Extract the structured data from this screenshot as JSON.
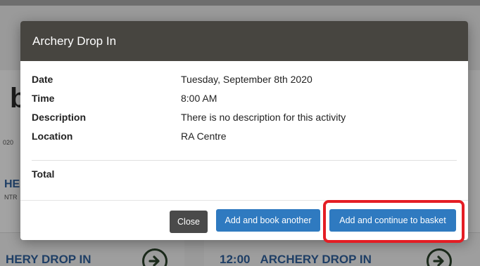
{
  "background": {
    "big_letter": "b",
    "small_date": "020",
    "partial_heading": "HE",
    "partial_sub": "NTR",
    "cards": [
      {
        "time": "",
        "title": "HERY DROP IN"
      },
      {
        "time": "12:00",
        "title": "ARCHERY DROP IN"
      }
    ]
  },
  "modal": {
    "title": "Archery Drop In",
    "details": {
      "date_label": "Date",
      "date_value": "Tuesday, September 8th 2020",
      "time_label": "Time",
      "time_value": "8:00 AM",
      "description_label": "Description",
      "description_value": "There is no description for this activity",
      "location_label": "Location",
      "location_value": "RA Centre",
      "total_label": "Total"
    },
    "buttons": {
      "close": "Close",
      "add_book_another": "Add and book another",
      "add_continue_basket": "Add and continue to basket"
    }
  },
  "colors": {
    "header_bg": "#474540",
    "primary_button": "#2f7ac0",
    "close_button": "#4a4a4a",
    "highlight": "#e41d24",
    "link_text": "#1f3f66"
  }
}
